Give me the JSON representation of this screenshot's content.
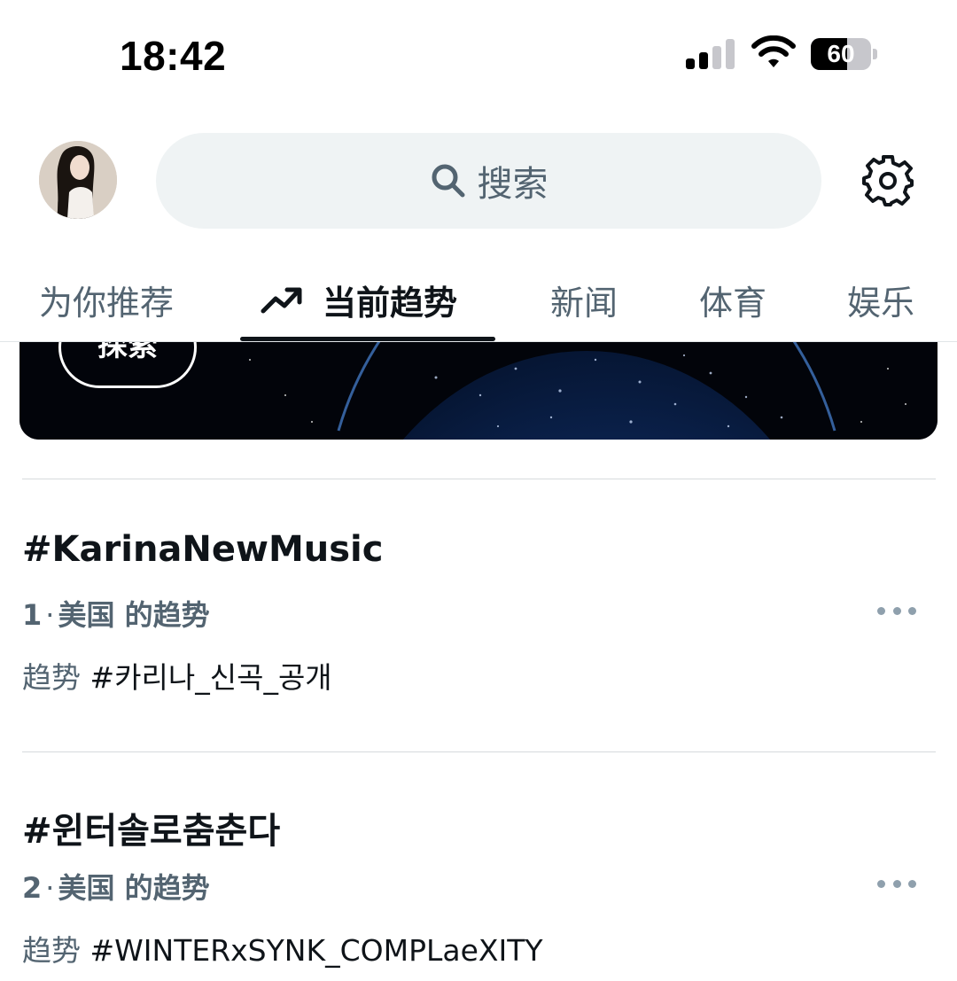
{
  "status_bar": {
    "time": "18:42",
    "battery_level": "60",
    "signal_bars_active": 2,
    "signal_bars_total": 4
  },
  "header": {
    "search_placeholder": "搜索"
  },
  "tabs": [
    {
      "label": "为你推荐",
      "active": false
    },
    {
      "label": "当前趋势",
      "active": true,
      "icon": "trending-icon"
    },
    {
      "label": "新闻",
      "active": false
    },
    {
      "label": "体育",
      "active": false
    },
    {
      "label": "娱乐",
      "active": false
    }
  ],
  "banner": {
    "button_label": "探索"
  },
  "trends": [
    {
      "title": "#KarinaNewMusic",
      "rank": "1",
      "separator": "·",
      "location": "美国 的趋势",
      "sub_label": "趋势",
      "sub_value": "#카리나_신곡_공개"
    },
    {
      "title": "#윈터솔로춤춘다",
      "rank": "2",
      "separator": "·",
      "location": "美国 的趋势",
      "sub_label": "趋势",
      "sub_value": "#WINTERxSYNK_COMPLaeXITY"
    }
  ],
  "colors": {
    "text_primary": "#0f1419",
    "text_secondary": "#536471",
    "search_bg": "#eff3f4",
    "divider": "#d6dadd"
  }
}
